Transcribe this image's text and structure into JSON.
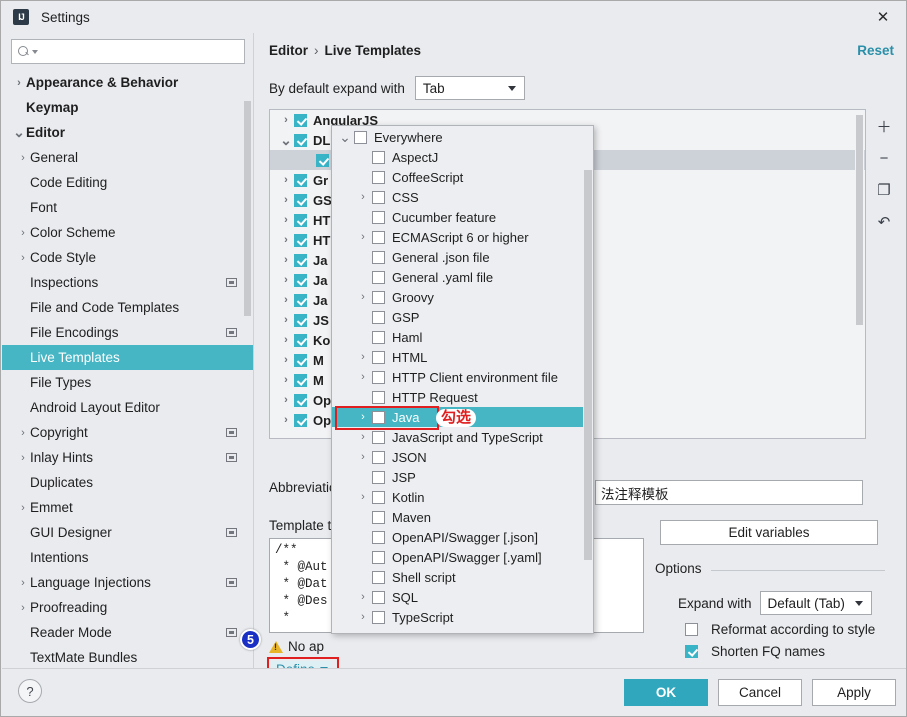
{
  "window": {
    "title": "Settings",
    "app_icon": "intellij-idea-icon",
    "close_icon": "close-icon"
  },
  "search": {
    "placeholder": "",
    "value": "",
    "icon": "search-icon"
  },
  "sidebar": {
    "items": [
      {
        "label": "Appearance & Behavior",
        "arrow": "collapsed",
        "level": 1,
        "bold": true,
        "selected": false,
        "badge": false
      },
      {
        "label": "Keymap",
        "arrow": "none",
        "level": 1,
        "bold": true,
        "selected": false,
        "badge": false
      },
      {
        "label": "Editor",
        "arrow": "expanded",
        "level": 1,
        "bold": true,
        "selected": false,
        "badge": false
      },
      {
        "label": "General",
        "arrow": "collapsed",
        "level": 2,
        "bold": false,
        "selected": false,
        "badge": false
      },
      {
        "label": "Code Editing",
        "arrow": "none",
        "level": 2,
        "bold": false,
        "selected": false,
        "badge": false
      },
      {
        "label": "Font",
        "arrow": "none",
        "level": 2,
        "bold": false,
        "selected": false,
        "badge": false
      },
      {
        "label": "Color Scheme",
        "arrow": "collapsed",
        "level": 2,
        "bold": false,
        "selected": false,
        "badge": false
      },
      {
        "label": "Code Style",
        "arrow": "collapsed",
        "level": 2,
        "bold": false,
        "selected": false,
        "badge": false
      },
      {
        "label": "Inspections",
        "arrow": "none",
        "level": 2,
        "bold": false,
        "selected": false,
        "badge": true
      },
      {
        "label": "File and Code Templates",
        "arrow": "none",
        "level": 2,
        "bold": false,
        "selected": false,
        "badge": false
      },
      {
        "label": "File Encodings",
        "arrow": "none",
        "level": 2,
        "bold": false,
        "selected": false,
        "badge": true
      },
      {
        "label": "Live Templates",
        "arrow": "none",
        "level": 2,
        "bold": false,
        "selected": true,
        "badge": false
      },
      {
        "label": "File Types",
        "arrow": "none",
        "level": 2,
        "bold": false,
        "selected": false,
        "badge": false
      },
      {
        "label": "Android Layout Editor",
        "arrow": "none",
        "level": 2,
        "bold": false,
        "selected": false,
        "badge": false
      },
      {
        "label": "Copyright",
        "arrow": "collapsed",
        "level": 2,
        "bold": false,
        "selected": false,
        "badge": true
      },
      {
        "label": "Inlay Hints",
        "arrow": "collapsed",
        "level": 2,
        "bold": false,
        "selected": false,
        "badge": true
      },
      {
        "label": "Duplicates",
        "arrow": "none",
        "level": 2,
        "bold": false,
        "selected": false,
        "badge": false
      },
      {
        "label": "Emmet",
        "arrow": "collapsed",
        "level": 2,
        "bold": false,
        "selected": false,
        "badge": false
      },
      {
        "label": "GUI Designer",
        "arrow": "none",
        "level": 2,
        "bold": false,
        "selected": false,
        "badge": true
      },
      {
        "label": "Intentions",
        "arrow": "none",
        "level": 2,
        "bold": false,
        "selected": false,
        "badge": false
      },
      {
        "label": "Language Injections",
        "arrow": "collapsed",
        "level": 2,
        "bold": false,
        "selected": false,
        "badge": true
      },
      {
        "label": "Proofreading",
        "arrow": "collapsed",
        "level": 2,
        "bold": false,
        "selected": false,
        "badge": false
      },
      {
        "label": "Reader Mode",
        "arrow": "none",
        "level": 2,
        "bold": false,
        "selected": false,
        "badge": true
      },
      {
        "label": "TextMate Bundles",
        "arrow": "none",
        "level": 2,
        "bold": false,
        "selected": false,
        "badge": false
      }
    ]
  },
  "main": {
    "breadcrumb": {
      "parent": "Editor",
      "separator": "›",
      "current": "Live Templates"
    },
    "reset_label": "Reset",
    "default_expand_label": "By default expand with",
    "default_expand_value": "Tab",
    "template_tree": [
      {
        "label": "AngularJS",
        "arrow": "collapsed",
        "checked": true,
        "child": false
      },
      {
        "label": "DL",
        "arrow": "expanded",
        "checked": true,
        "child": false
      },
      {
        "label": "",
        "arrow": "none",
        "checked": true,
        "child": true
      },
      {
        "label": "Gr",
        "arrow": "collapsed",
        "checked": true,
        "child": false
      },
      {
        "label": "GS",
        "arrow": "collapsed",
        "checked": true,
        "child": false
      },
      {
        "label": "HT",
        "arrow": "collapsed",
        "checked": true,
        "child": false
      },
      {
        "label": "HT",
        "arrow": "collapsed",
        "checked": true,
        "child": false
      },
      {
        "label": "Ja",
        "arrow": "collapsed",
        "checked": true,
        "child": false
      },
      {
        "label": "Ja",
        "arrow": "collapsed",
        "checked": true,
        "child": false
      },
      {
        "label": "Ja",
        "arrow": "collapsed",
        "checked": true,
        "child": false
      },
      {
        "label": "JS",
        "arrow": "collapsed",
        "checked": true,
        "child": false
      },
      {
        "label": "Ko",
        "arrow": "collapsed",
        "checked": true,
        "child": false
      },
      {
        "label": "M",
        "arrow": "collapsed",
        "checked": true,
        "child": false
      },
      {
        "label": "M",
        "arrow": "collapsed",
        "checked": true,
        "child": false
      },
      {
        "label": "Op",
        "arrow": "collapsed",
        "checked": true,
        "child": false
      },
      {
        "label": "Op",
        "arrow": "collapsed",
        "checked": true,
        "child": false
      }
    ],
    "tree_toolbar": [
      {
        "icon": "plus-icon",
        "glyph": "＋"
      },
      {
        "icon": "minus-icon",
        "glyph": "−"
      },
      {
        "icon": "copy-icon",
        "glyph": "❐"
      },
      {
        "icon": "revert-icon",
        "glyph": "↶"
      }
    ],
    "abbreviation_label": "Abbreviation:",
    "abbreviation_value": "",
    "description_value": "法注释模板",
    "template_text_label": "Template text:",
    "template_text": "/**\n * @Aut\n * @Dat\n * @Des\n *",
    "warning_text": "No ap",
    "define_label": "Define",
    "badge_number": "5",
    "edit_variables_label": "Edit variables",
    "options_title": "Options",
    "expand_with_label": "Expand with",
    "expand_with_value": "Default (Tab)",
    "reformat_label": "Reformat according to style",
    "reformat_checked": false,
    "shorten_label": "Shorten FQ names",
    "shorten_checked": true
  },
  "popup": {
    "annotation": "勾选",
    "items": [
      {
        "label": "Everywhere",
        "arrow": "expanded",
        "level": 1,
        "checked": false,
        "selected": false
      },
      {
        "label": "AspectJ",
        "arrow": "none",
        "level": 2,
        "checked": false,
        "selected": false
      },
      {
        "label": "CoffeeScript",
        "arrow": "none",
        "level": 2,
        "checked": false,
        "selected": false
      },
      {
        "label": "CSS",
        "arrow": "collapsed",
        "level": 2,
        "checked": false,
        "selected": false
      },
      {
        "label": "Cucumber feature",
        "arrow": "none",
        "level": 2,
        "checked": false,
        "selected": false
      },
      {
        "label": "ECMAScript 6 or higher",
        "arrow": "collapsed",
        "level": 2,
        "checked": false,
        "selected": false
      },
      {
        "label": "General .json file",
        "arrow": "none",
        "level": 2,
        "checked": false,
        "selected": false
      },
      {
        "label": "General .yaml file",
        "arrow": "none",
        "level": 2,
        "checked": false,
        "selected": false
      },
      {
        "label": "Groovy",
        "arrow": "collapsed",
        "level": 2,
        "checked": false,
        "selected": false
      },
      {
        "label": "GSP",
        "arrow": "none",
        "level": 2,
        "checked": false,
        "selected": false
      },
      {
        "label": "Haml",
        "arrow": "none",
        "level": 2,
        "checked": false,
        "selected": false
      },
      {
        "label": "HTML",
        "arrow": "collapsed",
        "level": 2,
        "checked": false,
        "selected": false
      },
      {
        "label": "HTTP Client environment file",
        "arrow": "collapsed",
        "level": 2,
        "checked": false,
        "selected": false
      },
      {
        "label": "HTTP Request",
        "arrow": "none",
        "level": 2,
        "checked": false,
        "selected": false
      },
      {
        "label": "Java",
        "arrow": "collapsed",
        "level": 2,
        "checked": false,
        "selected": true
      },
      {
        "label": "JavaScript and TypeScript",
        "arrow": "collapsed",
        "level": 2,
        "checked": false,
        "selected": false
      },
      {
        "label": "JSON",
        "arrow": "collapsed",
        "level": 2,
        "checked": false,
        "selected": false
      },
      {
        "label": "JSP",
        "arrow": "none",
        "level": 2,
        "checked": false,
        "selected": false
      },
      {
        "label": "Kotlin",
        "arrow": "collapsed",
        "level": 2,
        "checked": false,
        "selected": false
      },
      {
        "label": "Maven",
        "arrow": "none",
        "level": 2,
        "checked": false,
        "selected": false
      },
      {
        "label": "OpenAPI/Swagger [.json]",
        "arrow": "none",
        "level": 2,
        "checked": false,
        "selected": false
      },
      {
        "label": "OpenAPI/Swagger [.yaml]",
        "arrow": "none",
        "level": 2,
        "checked": false,
        "selected": false
      },
      {
        "label": "Shell script",
        "arrow": "none",
        "level": 2,
        "checked": false,
        "selected": false
      },
      {
        "label": "SQL",
        "arrow": "collapsed",
        "level": 2,
        "checked": false,
        "selected": false
      },
      {
        "label": "TypeScript",
        "arrow": "collapsed",
        "level": 2,
        "checked": false,
        "selected": false
      }
    ]
  },
  "footer": {
    "help_icon": "help-icon",
    "help_glyph": "?",
    "ok_label": "OK",
    "cancel_label": "Cancel",
    "apply_label": "Apply"
  },
  "colors": {
    "accent": "#31a7bd",
    "selection": "#46b5c4",
    "link": "#2a8fa8",
    "highlight_box": "#e02020",
    "badge": "#1a2fc4",
    "window_bg": "#e9ebef"
  }
}
